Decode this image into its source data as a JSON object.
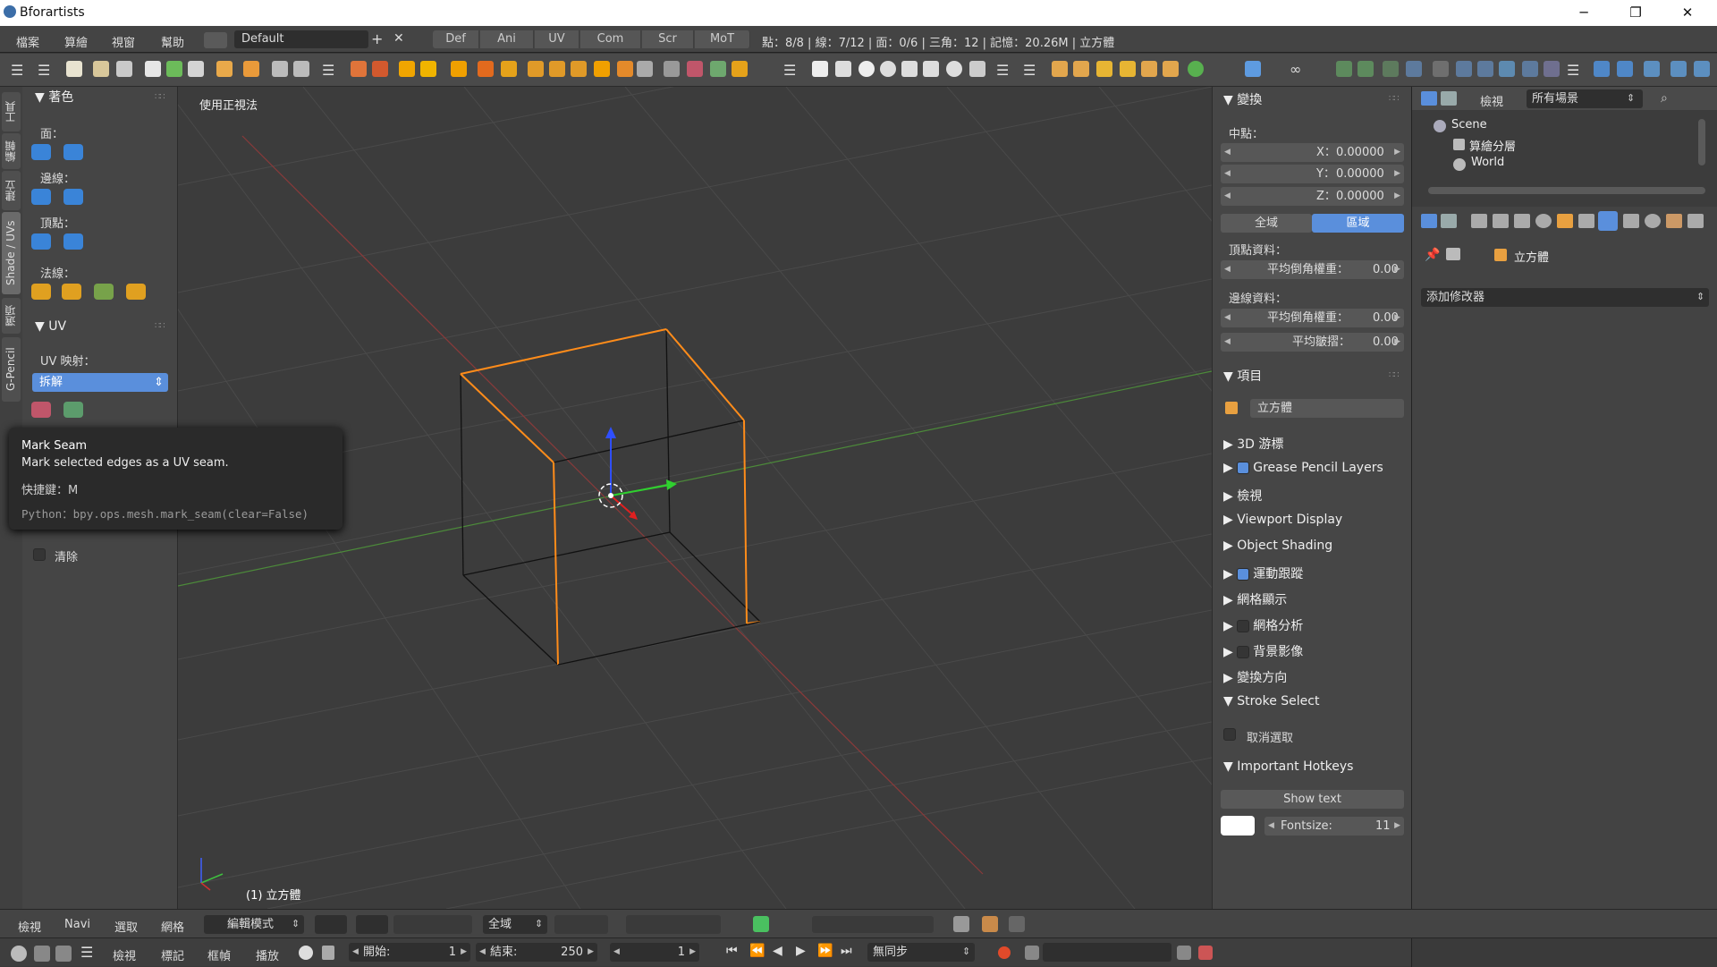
{
  "window": {
    "title": "Bforartists"
  },
  "menubar": {
    "items": [
      "檔案",
      "算繪",
      "視窗",
      "幫助"
    ],
    "layout_name": "Default",
    "tabs": [
      "Def",
      "Ani",
      "UV",
      "Com",
      "Scr",
      "MoT"
    ],
    "stats": "點：8/8 | 線：7/12 | 面：0/6 | 三角：12 | 記憶：20.26M | 立方體"
  },
  "left_tabs": [
    "工具",
    "編輯",
    "建立",
    "Shade / UVs",
    "選項",
    "G-Pencil"
  ],
  "shelf": {
    "shading_title": "著色",
    "face_label": "面：",
    "edge_label": "邊線：",
    "vertex_label": "頂點：",
    "normal_label": "法線：",
    "uv_title": "UV",
    "uv_map_label": "UV 映射：",
    "uv_map_value": "拆解",
    "clear_label": "清除"
  },
  "tooltip": {
    "title": "Mark Seam",
    "desc": "Mark selected edges as a UV seam.",
    "hotkey": "快捷鍵：M",
    "python": "Python：bpy.ops.mesh.mark_seam(clear=False)"
  },
  "viewport": {
    "view_name": "使用正視法",
    "object_label": "(1) 立方體"
  },
  "npanel": {
    "transform_title": "變換",
    "median_label": "中點：",
    "x_label": "X：",
    "x_value": "0.00000",
    "y_label": "Y：",
    "y_value": "0.00000",
    "z_label": "Z：",
    "z_value": "0.00000",
    "global_label": "全域",
    "local_label": "區域",
    "vertex_data_label": "頂點資料：",
    "mean_bevel_label": "平均倒角權重：",
    "mean_bevel_value": "0.00",
    "edge_data_label": "邊線資料：",
    "edge_bevel_label": "平均倒角權重：",
    "edge_bevel_value": "0.00",
    "crease_label": "平均皺摺：",
    "crease_value": "0.00",
    "item_title": "項目",
    "object_name": "立方體",
    "sections": [
      "3D 游標",
      "Grease Pencil Layers",
      "檢視",
      "Viewport Display",
      "Object Shading",
      "運動跟蹤",
      "網格顯示",
      "網格分析",
      "背景影像",
      "變換方向"
    ],
    "stroke_select_title": "Stroke Select",
    "deselect_label": "取消選取",
    "hotkeys_title": "Important Hotkeys",
    "show_text_label": "Show text",
    "fontsize_label": "Fontsize:",
    "fontsize_value": "11"
  },
  "outliner": {
    "view_label": "檢視",
    "filter_value": "所有場景",
    "tree": [
      "Scene",
      "算繪分層",
      "World"
    ]
  },
  "props": {
    "object_name": "立方體",
    "add_modifier": "添加修改器"
  },
  "bottombar": {
    "menus": [
      "檢視",
      "Navi",
      "選取",
      "網格"
    ],
    "mode": "編輯模式",
    "orientation": "全域"
  },
  "timeline": {
    "menus": [
      "檢視",
      "標記",
      "框幀",
      "播放"
    ],
    "start_label": "開始:",
    "start_value": "1",
    "end_label": "結束:",
    "end_value": "250",
    "current_frame": "1",
    "sync": "無同步"
  },
  "colors": {
    "accent": "#5a8fdc",
    "selection": "#ff8c1a"
  }
}
